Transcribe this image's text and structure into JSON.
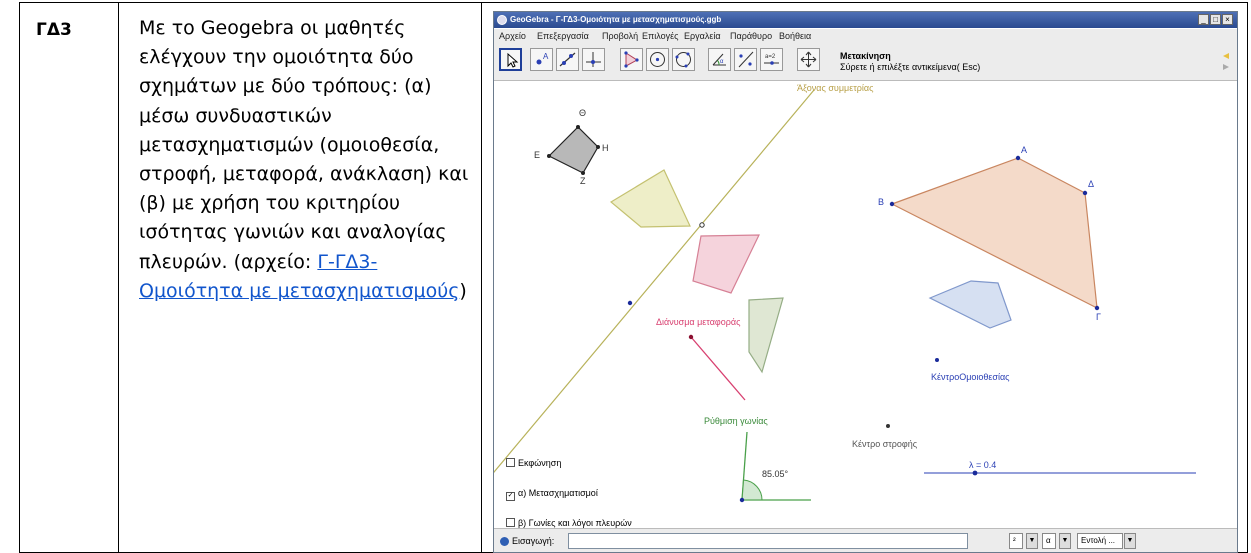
{
  "row": {
    "code": "ΓΔ3",
    "description": "Με το Geogebra οι μαθητές ελέγχουν την ομοιότητα δύο σχημάτων με δύο τρόπους: (α) μέσω συνδυαστικών μετασχηματισμών (ομοιοθεσία, στροφή, μεταφορά, ανάκλαση) και (β) με χρήση του κριτηρίου ισότητας γωνιών και αναλογίας πλευρών.",
    "file_prefix": "(αρχείο: ",
    "file_link": "Γ-ΓΔ3-Ομοιότητα με μετασχηματισμούς",
    "file_suffix": ")"
  },
  "window": {
    "title": "GeoGebra - Γ-ΓΔ3-Ομοιότητα με μετασχηματισμούς.ggb",
    "menu": [
      "Αρχείο",
      "Επεξεργασία",
      "Προβολή",
      "Επιλογές",
      "Εργαλεία",
      "Παράθυρο",
      "Βοήθεια"
    ],
    "tool_name": "Μετακίνηση",
    "tool_help": "Σύρετε ή επιλέξτε αντικείμενα( Esc)",
    "tools": [
      "move-tool-icon",
      "point-tool-icon",
      "line-tool-icon",
      "perpendicular-tool-icon",
      "polygon-tool-icon",
      "circle-tool-icon",
      "circle-3pt-tool-icon",
      "angle-tool-icon",
      "reflect-tool-icon",
      "slider-tool-icon",
      "move-view-tool-icon"
    ]
  },
  "canvas": {
    "axis_label": "Άξονας συμμετρίας",
    "vector_label": "Διάνυσμα μεταφοράς",
    "homothety_label": "ΚέντροΟμοιοθεσίας",
    "rotation_center_label": "Κέντρο στροφής",
    "rotation_angle_label": "Ρύθμιση γωνίας",
    "angle_value": "85.05°",
    "slider_label": "λ = 0.4",
    "vertices_small": [
      "Θ",
      "Ε",
      "Η",
      "Ζ"
    ],
    "vertices_big": [
      "Α",
      "Δ",
      "Β",
      "Γ"
    ],
    "checkboxes": [
      {
        "label": "Εκφώνηση",
        "checked": false
      },
      {
        "label": "α) Μετασχηματισμοί",
        "checked": true
      },
      {
        "label": "β) Γωνίες και λόγοι πλευρών",
        "checked": false
      }
    ]
  },
  "input_bar": {
    "label": "Εισαγωγή:",
    "value": "",
    "dropdown1": "²",
    "dropdown2": "α",
    "command_placeholder": "Εντολή ..."
  },
  "colors": {
    "link": "#1155cc",
    "titlebar": "#2a4a90",
    "big_quad_fill": "#f2d4c0",
    "blue_quad_fill": "#d6e0f2",
    "pink_quad_fill": "#f5d3dc",
    "yellow_quad_fill": "#eeeec8",
    "green_quad_fill": "#dfe7d3",
    "axis_line": "#b8b25a",
    "vector": "#d84070"
  }
}
